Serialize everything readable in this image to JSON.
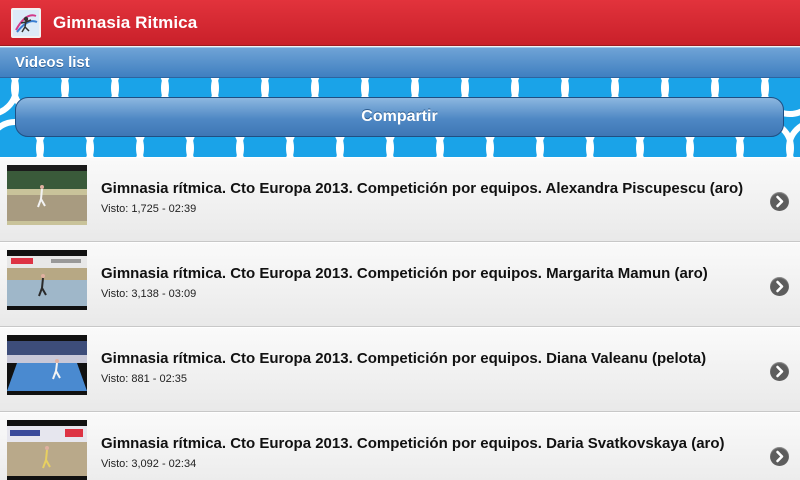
{
  "app": {
    "title": "Gimnasia Ritmica"
  },
  "subheader": {
    "label": "Videos list"
  },
  "share": {
    "label": "Compartir"
  },
  "videos": [
    {
      "title": "Gimnasia rítmica. Cto Europa 2013. Competición por equipos. Alexandra Piscupescu (aro)",
      "meta": "Visto: 1,725 - 02:39"
    },
    {
      "title": "Gimnasia rítmica. Cto Europa 2013. Competición por equipos. Margarita Mamun (aro)",
      "meta": "Visto: 3,138 - 03:09"
    },
    {
      "title": "Gimnasia rítmica. Cto Europa 2013. Competición por equipos. Diana Valeanu (pelota)",
      "meta": "Visto: 881 - 02:35"
    },
    {
      "title": "Gimnasia rítmica. Cto Europa 2013. Competición por equipos. Daria Svatkovskaya (aro)",
      "meta": "Visto: 3,092 - 02:34"
    }
  ],
  "icons": {
    "app": "gymnast-logo-icon",
    "row_action": "chevron-right-icon"
  },
  "colors": {
    "titlebar": "#d22a33",
    "subheader": "#4f88c4",
    "banner": "#1aa3e8",
    "button": "#4f88c4"
  }
}
